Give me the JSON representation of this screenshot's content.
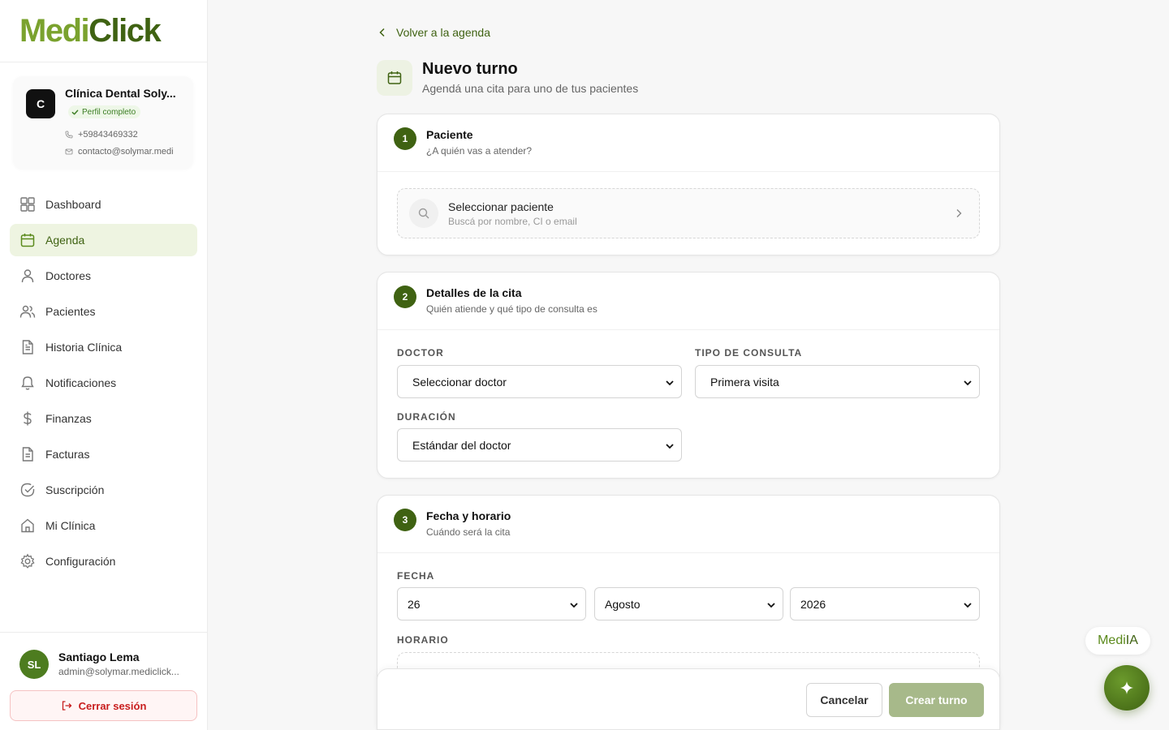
{
  "brand": {
    "part1": "Medi",
    "part2": "Click"
  },
  "clinic": {
    "initial": "C",
    "name": "Clínica Dental Soly...",
    "badge": "Perfil completo",
    "phone": "+59843469332",
    "email": "contacto@solymar.medi"
  },
  "nav": {
    "items": [
      {
        "label": "Dashboard"
      },
      {
        "label": "Agenda"
      },
      {
        "label": "Doctores"
      },
      {
        "label": "Pacientes"
      },
      {
        "label": "Historia Clínica"
      },
      {
        "label": "Notificaciones"
      },
      {
        "label": "Finanzas"
      },
      {
        "label": "Facturas"
      },
      {
        "label": "Suscripción"
      },
      {
        "label": "Mi Clínica"
      },
      {
        "label": "Configuración"
      }
    ],
    "active": "Agenda"
  },
  "user": {
    "initials": "SL",
    "name": "Santiago Lema",
    "email": "admin@solymar.mediclick...",
    "logout": "Cerrar sesión"
  },
  "page": {
    "back": "Volver a la agenda",
    "title": "Nuevo turno",
    "subtitle": "Agendá una cita para uno de tus pacientes"
  },
  "section1": {
    "step": "1",
    "title": "Paciente",
    "subtitle": "¿A quién vas a atender?",
    "select_title": "Seleccionar paciente",
    "select_hint": "Buscá por nombre, CI o email"
  },
  "section2": {
    "step": "2",
    "title": "Detalles de la cita",
    "subtitle": "Quién atiende y qué tipo de consulta es",
    "doctor_label": "DOCTOR",
    "doctor_value": "Seleccionar doctor",
    "tipo_label": "TIPO DE CONSULTA",
    "tipo_value": "Primera visita",
    "duracion_label": "DURACIÓN",
    "duracion_value": "Estándar del doctor"
  },
  "section3": {
    "step": "3",
    "title": "Fecha y horario",
    "subtitle": "Cuándo será la cita",
    "fecha_label": "FECHA",
    "day": "26",
    "month": "Agosto",
    "year": "2026",
    "horario_label": "HORARIO"
  },
  "actions": {
    "cancel": "Cancelar",
    "create": "Crear turno"
  },
  "assistant": {
    "label_a": "Medi",
    "label_b": "IA"
  },
  "colors": {
    "brand_dark": "#3f6212",
    "brand_light": "#7aa22e",
    "active_bg": "#eef4e1",
    "danger": "#c81e1e"
  }
}
